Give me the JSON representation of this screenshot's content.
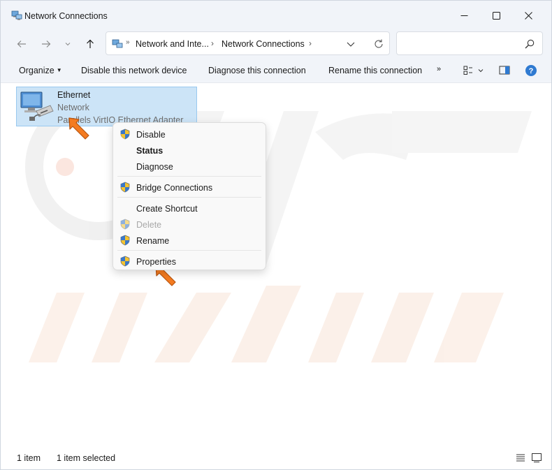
{
  "window": {
    "title": "Network Connections"
  },
  "address": {
    "crumb_1": "Network and Inte...",
    "crumb_2": "Network Connections",
    "separator": "›",
    "search_placeholder": ""
  },
  "commands": {
    "organize": "Organize",
    "disable": "Disable this network device",
    "diagnose": "Diagnose this connection",
    "rename": "Rename this connection",
    "more": "»"
  },
  "item": {
    "name": "Ethernet",
    "network": "Network",
    "adapter": "Parallels VirtIO Ethernet Adapter"
  },
  "context_menu": {
    "items": [
      {
        "label": "Disable",
        "icon": "uac-shield-icon"
      },
      {
        "label": "Status",
        "icon": ""
      },
      {
        "label": "Diagnose",
        "icon": ""
      },
      {
        "label": "Bridge Connections",
        "icon": "uac-shield-icon"
      },
      {
        "label": "Create Shortcut",
        "icon": ""
      },
      {
        "label": "Delete",
        "icon": "uac-shield-icon"
      },
      {
        "label": "Rename",
        "icon": "uac-shield-icon"
      },
      {
        "label": "Properties",
        "icon": "uac-shield-icon"
      }
    ]
  },
  "status": {
    "count": "1 item",
    "selected": "1 item selected"
  },
  "colors": {
    "accent": "#0067c0",
    "selection": "#cce4f7",
    "pointer_arrow": "#f47b20",
    "chrome": "#f1f4f9"
  }
}
